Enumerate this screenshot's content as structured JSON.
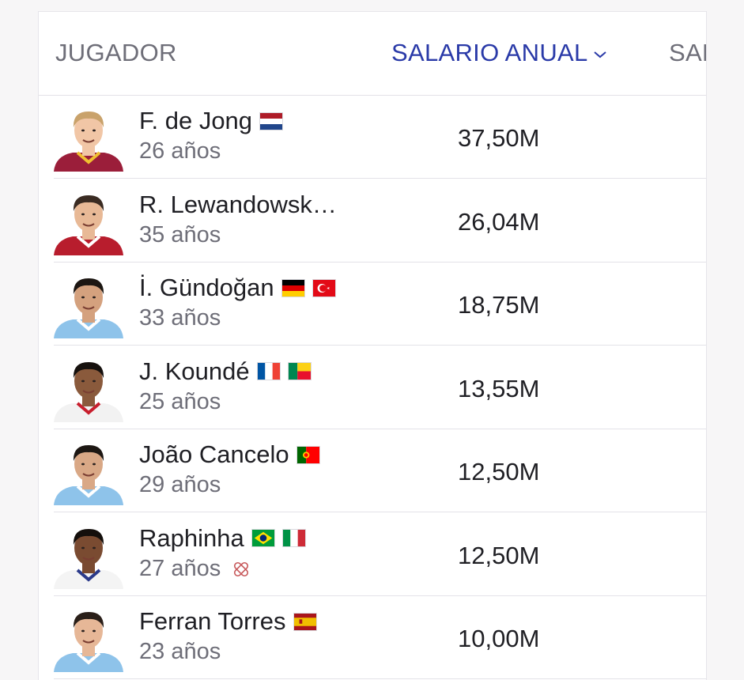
{
  "table": {
    "columns": {
      "player": "JUGADOR",
      "salary": "SALARIO ANUAL",
      "third": "SAL"
    },
    "sort_icon": "chevron-down-icon",
    "accent_color": "#2a3aa8",
    "rows": [
      {
        "name": "F. de Jong",
        "age": "26 años",
        "salary": "37,50M",
        "flags": [
          "netherlands"
        ],
        "shirt": "#9b1e3a",
        "trim": "#f0c030",
        "skin": "#f1c6a6",
        "hair": "#c9a26b"
      },
      {
        "name": "R. Lewandowsk…",
        "age": "35 años",
        "salary": "26,04M",
        "flags": [],
        "shirt": "#b81d2d",
        "trim": "#ffffff",
        "skin": "#e8b996",
        "hair": "#3a2b22"
      },
      {
        "name": "İ. Gündoğan",
        "age": "33 años",
        "salary": "18,75M",
        "flags": [
          "germany",
          "turkey"
        ],
        "shirt": "#8ec3ea",
        "trim": "#ffffff",
        "skin": "#d4a17e",
        "hair": "#1c1612"
      },
      {
        "name": "J. Koundé",
        "age": "25 años",
        "salary": "13,55M",
        "flags": [
          "france",
          "benin"
        ],
        "shirt": "#f2f2f2",
        "trim": "#c81e2d",
        "skin": "#8a5a3c",
        "hair": "#16110e"
      },
      {
        "name": "João Cancelo",
        "age": "29 años",
        "salary": "12,50M",
        "flags": [
          "portugal"
        ],
        "shirt": "#8ec3ea",
        "trim": "#ffffff",
        "skin": "#d9a886",
        "hair": "#1d1713"
      },
      {
        "name": "Raphinha",
        "age": "27 años",
        "salary": "12,50M",
        "flags": [
          "brazil",
          "italy"
        ],
        "shirt": "#f4f4f4",
        "trim": "#2b3a8a",
        "skin": "#7a4b31",
        "hair": "#140f0c",
        "injured": true
      },
      {
        "name": "Ferran Torres",
        "age": "23 años",
        "salary": "10,00M",
        "flags": [
          "spain"
        ],
        "shirt": "#8ec3ea",
        "trim": "#ffffff",
        "skin": "#e6b797",
        "hair": "#2a1f19"
      }
    ]
  }
}
